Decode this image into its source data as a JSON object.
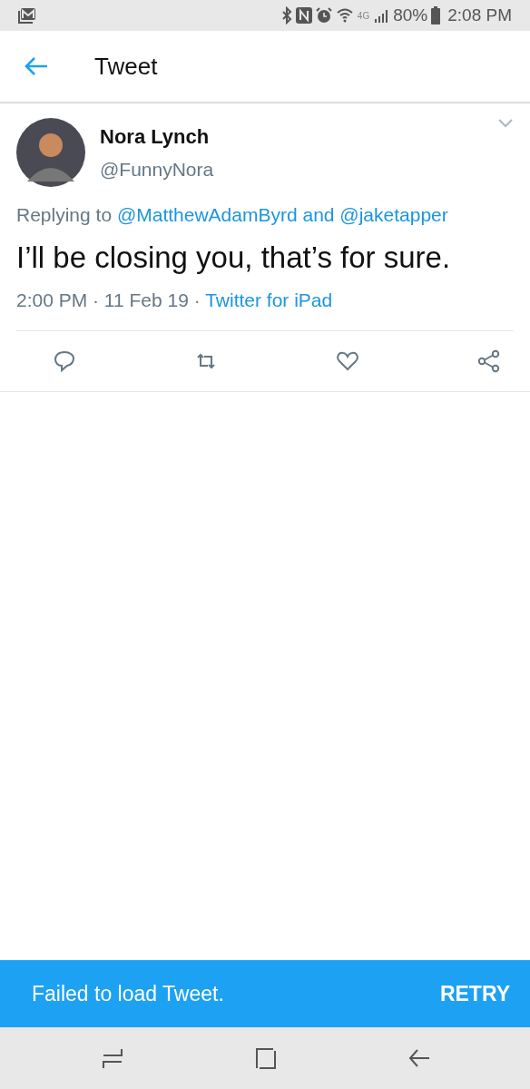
{
  "status_bar": {
    "network": "4G",
    "battery": "80%",
    "time": "2:08 PM"
  },
  "header": {
    "title": "Tweet"
  },
  "tweet": {
    "name": "Nora Lynch",
    "handle": "@FunnyNora",
    "replying": {
      "prefix": "Replying to",
      "mentions": [
        "@MatthewAdamByrd",
        "@jaketapper"
      ],
      "joiner": "and"
    },
    "text": "I’ll be closing you, that’s for sure.",
    "meta": "2:00 PM · 11 Feb 19 ·",
    "source": "Twitter for iPad",
    "actions": [
      {
        "kind": "reply"
      },
      {
        "kind": "retweet"
      },
      {
        "kind": "like"
      },
      {
        "kind": "share"
      }
    ]
  },
  "snackbar": {
    "message": "Failed to load Tweet.",
    "action": "RETRY"
  }
}
